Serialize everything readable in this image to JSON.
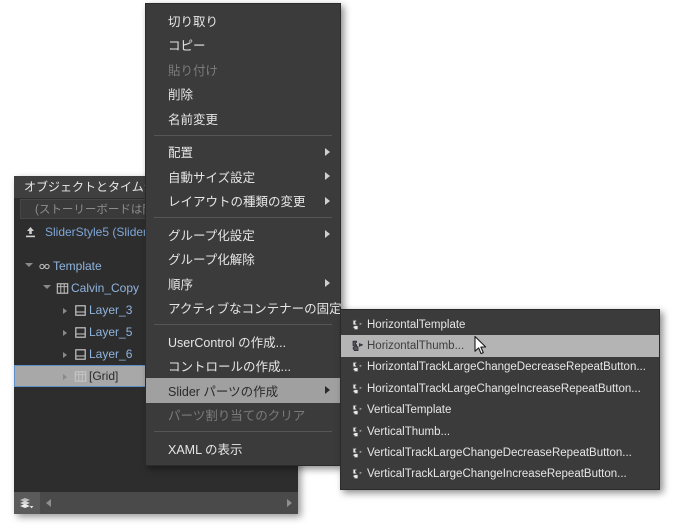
{
  "panel": {
    "title": "オブジェクトとタイムライ",
    "subtitle": "(ストーリーボードは開い",
    "root": {
      "label": "SliderStyle5 (Slider ",
      "icon": "export-icon"
    },
    "tree": [
      {
        "label": "Template",
        "depth": 0,
        "twisty": "open",
        "icon": "template-icon",
        "selected": false
      },
      {
        "label": "Calvin_Copy",
        "depth": 1,
        "twisty": "open",
        "icon": "grid-icon",
        "selected": false
      },
      {
        "label": "Layer_3",
        "depth": 2,
        "twisty": "closed",
        "icon": "border-icon",
        "selected": false
      },
      {
        "label": "Layer_5",
        "depth": 2,
        "twisty": "closed",
        "icon": "border-icon",
        "selected": false
      },
      {
        "label": "Layer_6",
        "depth": 2,
        "twisty": "closed",
        "icon": "border-icon",
        "selected": false
      },
      {
        "label": "[Grid]",
        "depth": 2,
        "twisty": "closed",
        "icon": "grid-icon",
        "selected": true
      }
    ],
    "footer": {
      "button_icon": "layers-down-icon",
      "scroll_left_icon": "arrow-left-icon",
      "scroll_right_icon": "arrow-right-icon"
    }
  },
  "context_menu": {
    "items": [
      {
        "label": "切り取り",
        "disabled": false,
        "submenu": false,
        "highlight": false
      },
      {
        "label": "コピー",
        "disabled": false,
        "submenu": false,
        "highlight": false
      },
      {
        "label": "貼り付け",
        "disabled": true,
        "submenu": false,
        "highlight": false
      },
      {
        "label": "削除",
        "disabled": false,
        "submenu": false,
        "highlight": false
      },
      {
        "label": "名前変更",
        "disabled": false,
        "submenu": false,
        "highlight": false
      },
      {
        "separator": true
      },
      {
        "label": "配置",
        "disabled": false,
        "submenu": true,
        "highlight": false
      },
      {
        "label": "自動サイズ設定",
        "disabled": false,
        "submenu": true,
        "highlight": false
      },
      {
        "label": "レイアウトの種類の変更",
        "disabled": false,
        "submenu": true,
        "highlight": false
      },
      {
        "separator": true
      },
      {
        "label": "グループ化設定",
        "disabled": false,
        "submenu": true,
        "highlight": false
      },
      {
        "label": "グループ化解除",
        "disabled": false,
        "submenu": false,
        "highlight": false
      },
      {
        "label": "順序",
        "disabled": false,
        "submenu": true,
        "highlight": false
      },
      {
        "label": "アクティブなコンテナーの固定",
        "disabled": false,
        "submenu": false,
        "highlight": false
      },
      {
        "separator": true
      },
      {
        "label": "UserControl の作成...",
        "disabled": false,
        "submenu": false,
        "highlight": false
      },
      {
        "label": "コントロールの作成...",
        "disabled": false,
        "submenu": false,
        "highlight": false
      },
      {
        "label": "Slider パーツの作成",
        "disabled": false,
        "submenu": true,
        "highlight": true
      },
      {
        "label": "パーツ割り当てのクリア",
        "disabled": true,
        "submenu": false,
        "highlight": false
      },
      {
        "separator": true
      },
      {
        "label": "XAML の表示",
        "disabled": false,
        "submenu": false,
        "highlight": false
      }
    ]
  },
  "submenu": {
    "items": [
      {
        "label": "HorizontalTemplate",
        "icon": "puzzle-icon",
        "highlight": false
      },
      {
        "label": "HorizontalThumb...",
        "icon": "puzzle-icon",
        "highlight": true
      },
      {
        "label": "HorizontalTrackLargeChangeDecreaseRepeatButton...",
        "icon": "puzzle-icon",
        "highlight": false
      },
      {
        "label": "HorizontalTrackLargeChangeIncreaseRepeatButton...",
        "icon": "puzzle-icon",
        "highlight": false
      },
      {
        "label": "VerticalTemplate",
        "icon": "puzzle-icon",
        "highlight": false
      },
      {
        "label": "VerticalThumb...",
        "icon": "puzzle-icon",
        "highlight": false
      },
      {
        "label": "VerticalTrackLargeChangeDecreaseRepeatButton...",
        "icon": "puzzle-icon",
        "highlight": false
      },
      {
        "label": "VerticalTrackLargeChangeIncreaseRepeatButton...",
        "icon": "puzzle-icon",
        "highlight": false
      }
    ]
  },
  "cursor": {
    "icon": "mouse-pointer-icon"
  },
  "colors": {
    "panel_bg": "#2d2d2d",
    "menu_bg": "#3b3b3b",
    "highlight": "#a0a0a0",
    "submenu_highlight": "#b4b4b4",
    "tree_text": "#8fb4de",
    "selection_outline": "#5d8fc9",
    "disabled_text": "#7b7b7b"
  }
}
